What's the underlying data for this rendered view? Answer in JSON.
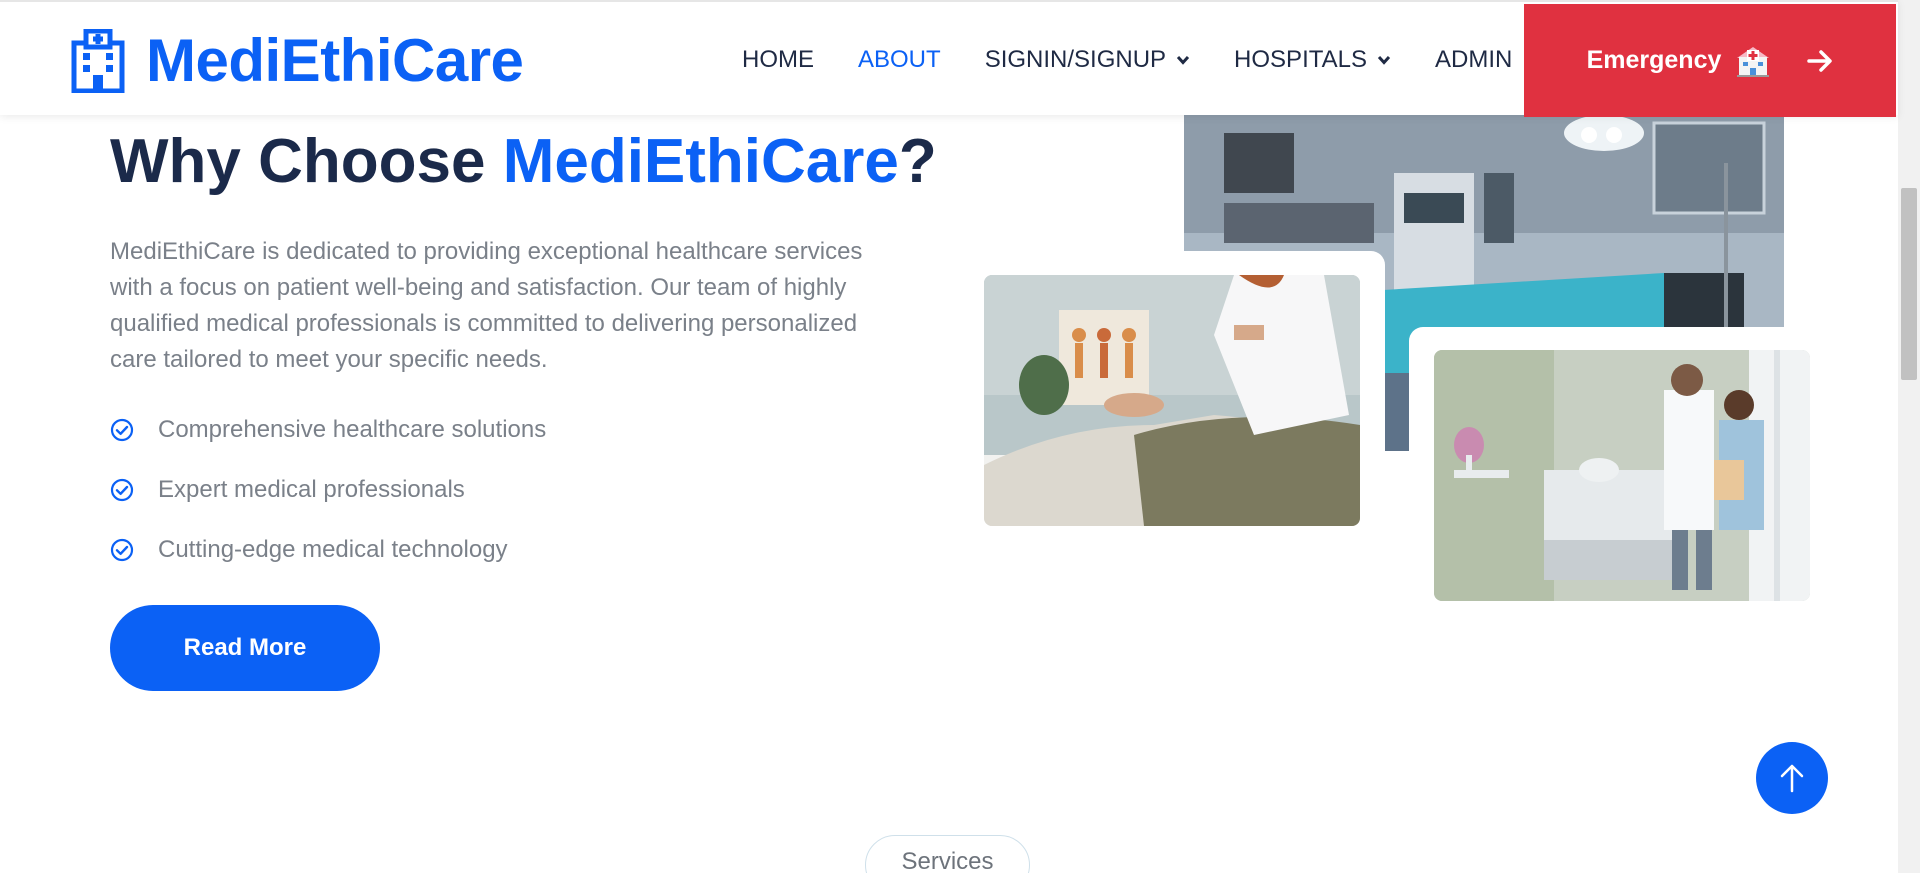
{
  "header": {
    "brand": "MediEthiCare",
    "nav": [
      {
        "label": "HOME",
        "active": false,
        "dropdown": false
      },
      {
        "label": "ABOUT",
        "active": true,
        "dropdown": false
      },
      {
        "label": "SIGNIN/SIGNUP",
        "active": false,
        "dropdown": true
      },
      {
        "label": "HOSPITALS",
        "active": false,
        "dropdown": true
      },
      {
        "label": "ADMIN",
        "active": false,
        "dropdown": false
      }
    ],
    "emergency_label": "Emergency"
  },
  "about": {
    "heading_prefix": "Why Choose ",
    "heading_brand": "MediEthiCare",
    "heading_suffix": "?",
    "paragraph": "MediEthiCare is dedicated to providing exceptional healthcare services with a focus on patient well-being and satisfaction. Our team of highly qualified medical professionals is committed to delivering personalized care tailored to meet your specific needs.",
    "features": [
      "Comprehensive healthcare solutions",
      "Expert medical professionals",
      "Cutting-edge medical technology"
    ],
    "read_more_label": "Read More"
  },
  "services_pill": "Services",
  "colors": {
    "brand_blue": "#0b61f5",
    "emergency_red": "#e03140",
    "heading_dark": "#1b2a4a",
    "body_gray": "#7a8089"
  },
  "icons": {
    "logo": "hospital-building-icon",
    "emergency": "hospital-icon",
    "arrow": "arrow-right-icon",
    "feature": "check-circle-icon",
    "back_to_top": "arrow-up-icon"
  }
}
